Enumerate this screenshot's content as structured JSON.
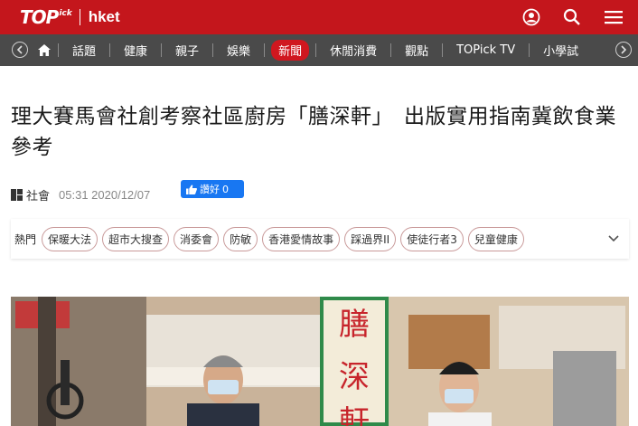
{
  "header": {
    "logo_text": "TOP",
    "logo_sub": "ick",
    "brand": "hket"
  },
  "nav": {
    "items": [
      "話題",
      "健康",
      "親子",
      "娛樂",
      "新聞",
      "休閒消費",
      "觀點",
      "TOPick TV",
      "小學試"
    ],
    "active": "新聞"
  },
  "article": {
    "title": "理大賽馬會社創考察社區廚房「膳深軒」　出版實用指南冀飲食業參考",
    "category": "社會",
    "datetime": "05:31 2020/12/07",
    "like_label": "讚好",
    "like_count": "0"
  },
  "hot": {
    "label": "熱門",
    "tags": [
      "保暖大法",
      "超市大搜查",
      "消委會",
      "防敏",
      "香港愛情故事",
      "踩過界II",
      "使徒行者3",
      "兒童健康"
    ]
  },
  "photo": {
    "banner_chars": [
      "膳",
      "深",
      "軒"
    ]
  },
  "colors": {
    "brand_red": "#c4161c",
    "nav_bg": "#4a4a4a",
    "like_blue": "#1877f2"
  }
}
